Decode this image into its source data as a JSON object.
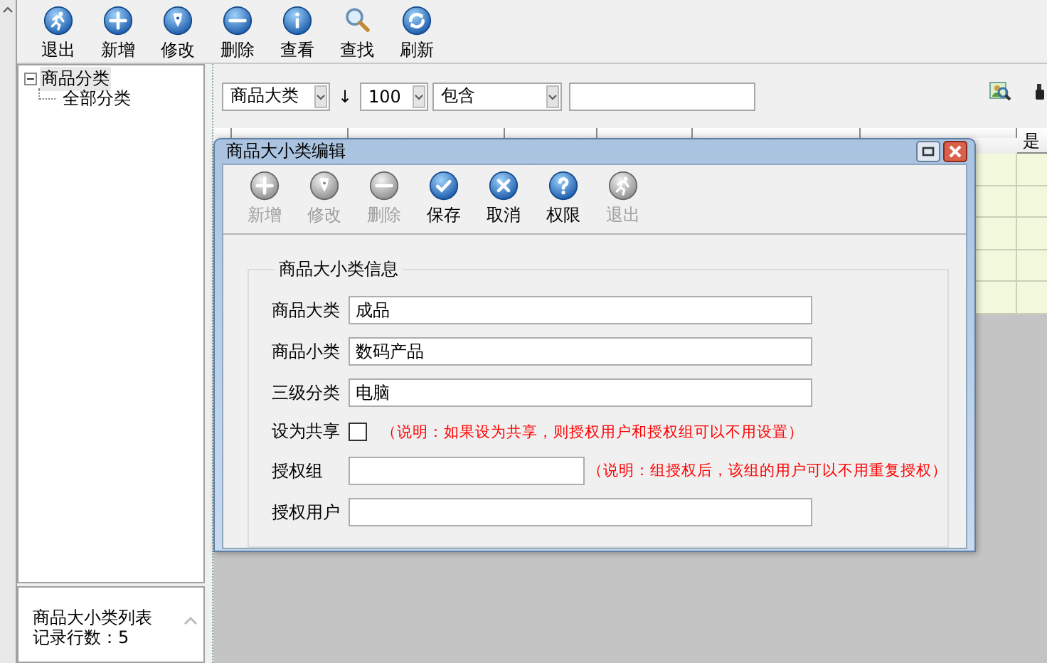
{
  "toolbar": [
    {
      "label": "退出",
      "kind": "exit"
    },
    {
      "label": "新增",
      "kind": "add"
    },
    {
      "label": "修改",
      "kind": "edit"
    },
    {
      "label": "删除",
      "kind": "delete"
    },
    {
      "label": "查看",
      "kind": "info"
    },
    {
      "label": "查找",
      "kind": "find"
    },
    {
      "label": "刷新",
      "kind": "refresh"
    }
  ],
  "tree": {
    "label": "商品分类",
    "expanded": true,
    "children": [
      {
        "label": "全部分类"
      }
    ]
  },
  "status": {
    "lines": [
      "商品大小类列表",
      "记录行数：5"
    ]
  },
  "filter": {
    "field": "商品大类",
    "sort": "↓",
    "limit": "100",
    "operator": "包含"
  },
  "grid": {
    "last_column": "是"
  },
  "dialog": {
    "title": "商品大小类编辑",
    "toolbar": [
      {
        "label": "新增",
        "kind": "add",
        "disabled": true
      },
      {
        "label": "修改",
        "kind": "edit",
        "disabled": true
      },
      {
        "label": "删除",
        "kind": "delete",
        "disabled": true
      },
      {
        "label": "保存",
        "kind": "save",
        "disabled": false
      },
      {
        "label": "取消",
        "kind": "cancel",
        "disabled": false
      },
      {
        "label": "权限",
        "kind": "help",
        "disabled": false
      },
      {
        "label": "退出",
        "kind": "exit",
        "disabled": true
      }
    ],
    "group": "商品大小类信息",
    "fields": [
      {
        "label": "商品大类",
        "kind": "text",
        "value": "成品"
      },
      {
        "label": "商品小类",
        "kind": "text",
        "value": "数码产品"
      },
      {
        "label": "三级分类",
        "kind": "text",
        "value": "电脑"
      },
      {
        "label": "设为共享",
        "kind": "checkbox",
        "checked": false,
        "note": "（说明：如果设为共享，则授权用户和授权组可以不用设置）"
      },
      {
        "label": "授权组",
        "kind": "text",
        "note": "（说明：组授权后，该组的用户可以不用重复授权）"
      },
      {
        "label": "授权用户",
        "kind": "text"
      }
    ]
  }
}
